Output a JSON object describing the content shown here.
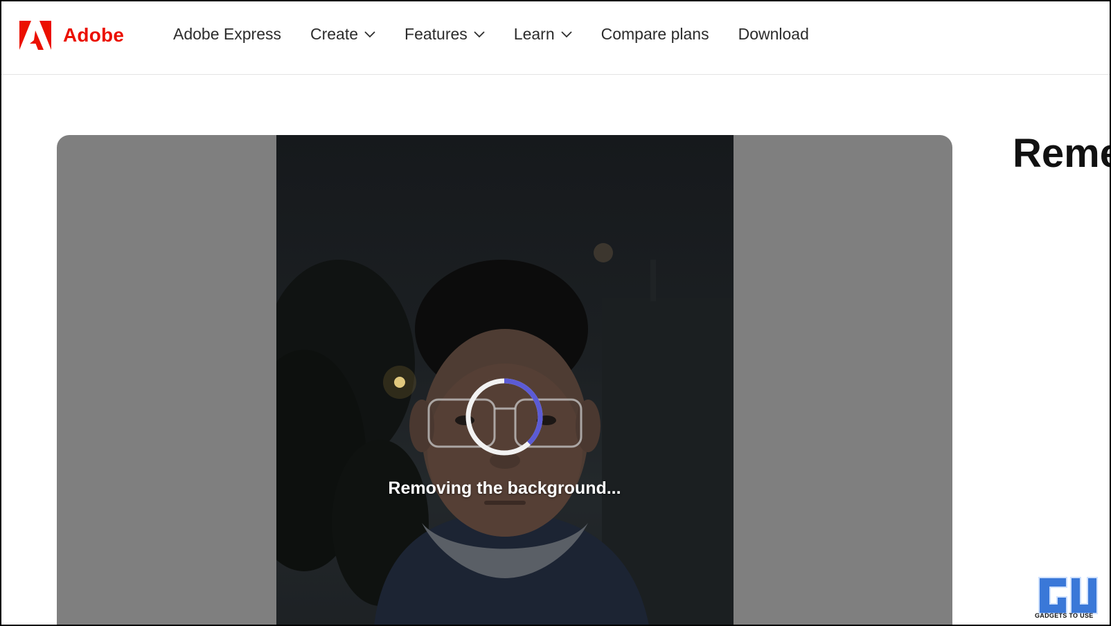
{
  "brand": {
    "name": "Adobe",
    "color": "#eb1000",
    "icon": "adobe-logo-icon"
  },
  "nav": {
    "items": [
      {
        "label": "Adobe Express",
        "has_dropdown": false
      },
      {
        "label": "Create",
        "has_dropdown": true
      },
      {
        "label": "Features",
        "has_dropdown": true
      },
      {
        "label": "Learn",
        "has_dropdown": true
      },
      {
        "label": "Compare plans",
        "has_dropdown": false
      },
      {
        "label": "Download",
        "has_dropdown": false
      }
    ]
  },
  "editor": {
    "status_text": "Removing the background...",
    "spinner": {
      "icon": "loading-spinner-icon",
      "accent": "#5b5bd6",
      "progress": 0.38
    }
  },
  "side": {
    "heading": "Reme"
  },
  "watermark": {
    "text": "GADGETS TO USE",
    "icon": "gadgets-to-use-logo",
    "color": "#3a78d8"
  }
}
